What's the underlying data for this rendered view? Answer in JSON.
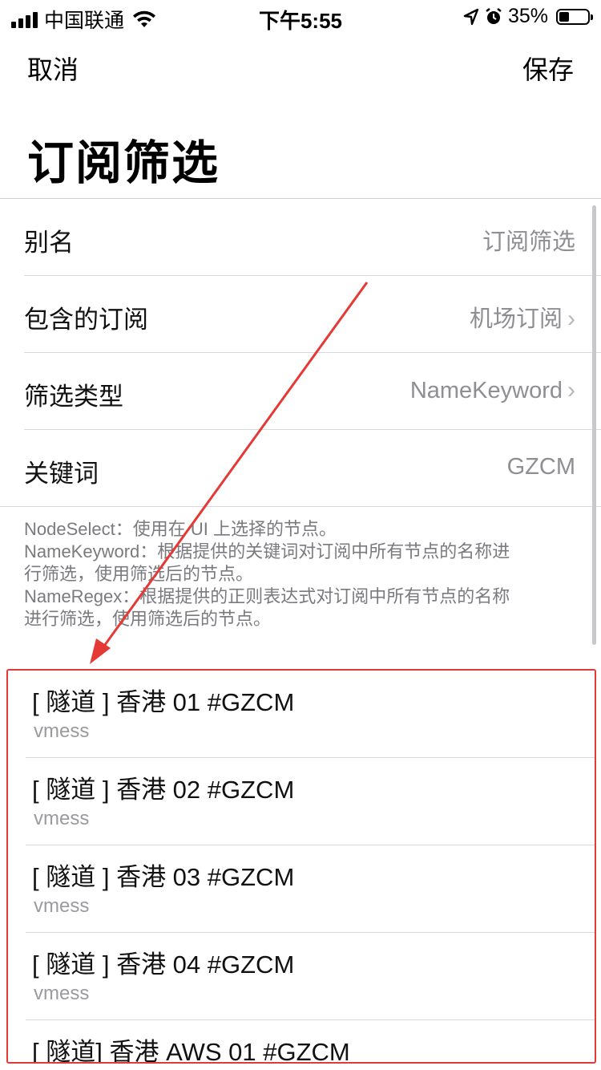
{
  "status_bar": {
    "carrier": "中国联通",
    "time": "下午5:55",
    "battery_percent": "35%",
    "icons": [
      "signal-icon",
      "wifi-icon",
      "location-icon",
      "alarm-icon",
      "battery-icon"
    ]
  },
  "nav": {
    "cancel_label": "取消",
    "save_label": "保存"
  },
  "page_title": "订阅筛选",
  "form": {
    "rows": [
      {
        "label": "别名",
        "value": "订阅筛选"
      },
      {
        "label": "包含的订阅",
        "value": "机场订阅"
      },
      {
        "label": "筛选类型",
        "value": "NameKeyword"
      },
      {
        "label": "关键词",
        "value": "GZCM"
      }
    ],
    "note_lines": [
      "NodeSelect：使用在 UI 上选择的节点。",
      "NameKeyword：根据提供的关键词对订阅中所有节点的名称进",
      "行筛选，使用筛选后的节点。",
      "NameRegex：根据提供的正则表达式对订阅中所有节点的名称",
      "进行筛选，使用筛选后的节点。"
    ]
  },
  "nodes": [
    {
      "name": "[ 隧道 ] 香港 01 #GZCM",
      "type": "vmess"
    },
    {
      "name": "[ 隧道 ] 香港 02  #GZCM",
      "type": "vmess"
    },
    {
      "name": "[ 隧道 ] 香港 03 #GZCM",
      "type": "vmess"
    },
    {
      "name": "[ 隧道 ] 香港 04 #GZCM",
      "type": "vmess"
    },
    {
      "name": "[ 隧道] 香港 AWS 01 #GZCM",
      "type": ""
    }
  ],
  "colors": {
    "annotation_red": "#e53935",
    "secondary_text": "#8e8e93",
    "separator": "#d8d8dc"
  }
}
